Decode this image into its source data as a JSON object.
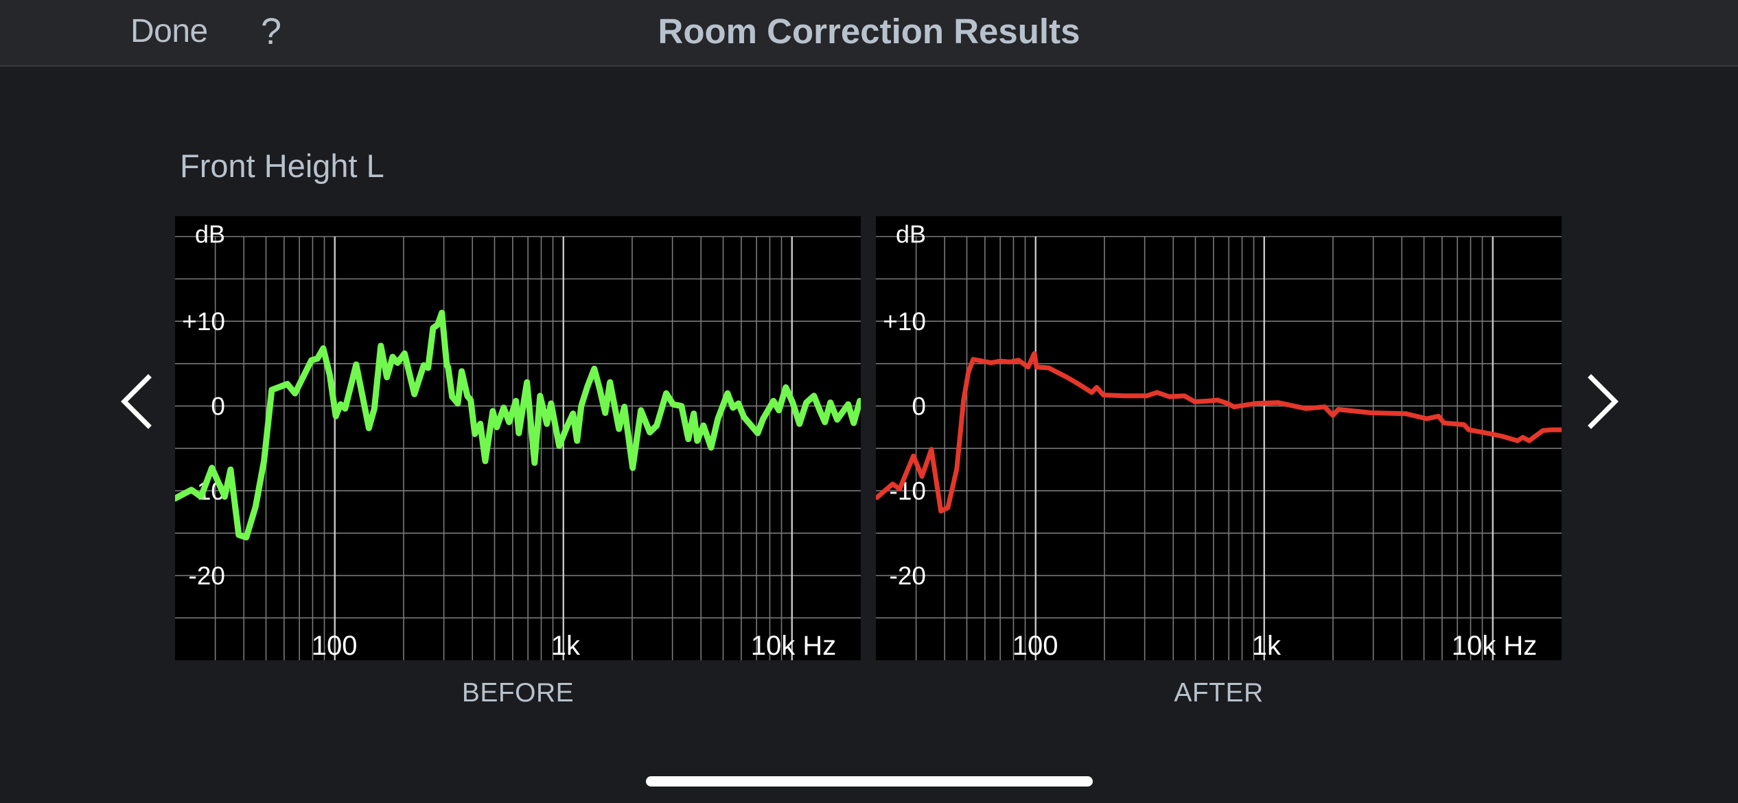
{
  "header": {
    "done_label": "Done",
    "help_label": "?",
    "title": "Room Correction Results"
  },
  "speaker": {
    "name": "Front Height L"
  },
  "navigation": {
    "prev_icon": "chevron-left-icon",
    "next_icon": "chevron-right-icon"
  },
  "colors": {
    "before_curve": "#72f74f",
    "after_curve": "#e5372a",
    "plot_background": "#000000",
    "grid_minor": "#7a7a7a",
    "grid_major": "#c8c8c8",
    "text": "#b8c2cc"
  },
  "chart_data": [
    {
      "type": "line",
      "title": "BEFORE",
      "xlabel": "Hz",
      "ylabel": "dB",
      "xscale": "log",
      "xlim": [
        20,
        20000
      ],
      "ylim": [
        -30,
        22.4
      ],
      "grid": true,
      "y_gridlines": [
        20,
        15,
        10,
        5,
        0,
        -5,
        -10,
        -15,
        -20,
        -25
      ],
      "x_gridlines": [
        30,
        40,
        50,
        60,
        70,
        80,
        90,
        100,
        200,
        300,
        400,
        500,
        600,
        700,
        800,
        900,
        1000,
        2000,
        3000,
        4000,
        5000,
        6000,
        7000,
        8000,
        9000,
        10000
      ],
      "x_major_gridlines": [
        100,
        1000,
        10000
      ],
      "y_tick_labels": [
        {
          "value": 10,
          "label": "+10"
        },
        {
          "value": 0,
          "label": "0"
        },
        {
          "value": -10,
          "label": "-10"
        },
        {
          "value": -20,
          "label": "-20"
        }
      ],
      "y_unit_label": "dB",
      "x_tick_labels": [
        {
          "value": 100,
          "label": "100"
        },
        {
          "value": 1000,
          "label": "1k"
        },
        {
          "value": 10000,
          "label": "10k Hz"
        }
      ],
      "series": [
        {
          "name": "Before",
          "color": "#72f74f",
          "points": [
            [
              20,
              -10.9
            ],
            [
              23.6,
              -9.9
            ],
            [
              26,
              -10.7
            ],
            [
              29,
              -7.3
            ],
            [
              33,
              -10.7
            ],
            [
              35,
              -7.5
            ],
            [
              38,
              -15.2
            ],
            [
              41,
              -15.5
            ],
            [
              45,
              -11.9
            ],
            [
              49,
              -6.5
            ],
            [
              53,
              1.9
            ],
            [
              62,
              2.6
            ],
            [
              67,
              1.5
            ],
            [
              79,
              5.4
            ],
            [
              84,
              5.6
            ],
            [
              89,
              6.8
            ],
            [
              95,
              3.7
            ],
            [
              101,
              -1.2
            ],
            [
              106,
              0.2
            ],
            [
              111,
              -0.3
            ],
            [
              124,
              4.9
            ],
            [
              141,
              -2.6
            ],
            [
              149,
              -0.3
            ],
            [
              159,
              7.1
            ],
            [
              169,
              3.4
            ],
            [
              179,
              5.8
            ],
            [
              188,
              5.1
            ],
            [
              202,
              6.2
            ],
            [
              223,
              1.4
            ],
            [
              245,
              4.8
            ],
            [
              256,
              4.5
            ],
            [
              269,
              9.2
            ],
            [
              282,
              9.6
            ],
            [
              294,
              11.0
            ],
            [
              309,
              4.8
            ],
            [
              313,
              4.6
            ],
            [
              326,
              1.1
            ],
            [
              345,
              0.3
            ],
            [
              359,
              4.1
            ],
            [
              380,
              1.2
            ],
            [
              393,
              0.7
            ],
            [
              410,
              -3.3
            ],
            [
              433,
              -2.1
            ],
            [
              455,
              -6.5
            ],
            [
              491,
              -0.6
            ],
            [
              511,
              -2.5
            ],
            [
              548,
              -0.2
            ],
            [
              579,
              -1.9
            ],
            [
              620,
              0.6
            ],
            [
              638,
              -3.2
            ],
            [
              693,
              2.8
            ],
            [
              748,
              -6.7
            ],
            [
              791,
              1.2
            ],
            [
              847,
              -2.1
            ],
            [
              883,
              0.3
            ],
            [
              959,
              -4.7
            ],
            [
              1042,
              -2.3
            ],
            [
              1102,
              -0.9
            ],
            [
              1148,
              -4.1
            ],
            [
              1197,
              0.0
            ],
            [
              1274,
              2.3
            ],
            [
              1365,
              4.4
            ],
            [
              1442,
              2.0
            ],
            [
              1524,
              -0.8
            ],
            [
              1600,
              2.8
            ],
            [
              1750,
              -2.7
            ],
            [
              1849,
              -0.1
            ],
            [
              2010,
              -7.3
            ],
            [
              2184,
              -0.5
            ],
            [
              2389,
              -3.1
            ],
            [
              2560,
              -2.3
            ],
            [
              2818,
              1.5
            ],
            [
              3020,
              0.2
            ],
            [
              3285,
              0.0
            ],
            [
              3521,
              -3.9
            ],
            [
              3720,
              -0.9
            ],
            [
              3853,
              -4.1
            ],
            [
              4100,
              -2.3
            ],
            [
              4426,
              -4.9
            ],
            [
              4742,
              -1.5
            ],
            [
              5224,
              1.5
            ],
            [
              5521,
              -0.2
            ],
            [
              5834,
              0.3
            ],
            [
              6166,
              -1.3
            ],
            [
              7079,
              -3.2
            ],
            [
              7482,
              -1.5
            ],
            [
              8299,
              0.6
            ],
            [
              8770,
              -0.5
            ],
            [
              9397,
              2.2
            ],
            [
              10069,
              0.4
            ],
            [
              10789,
              -2.1
            ],
            [
              11561,
              0.4
            ],
            [
              12477,
              1.2
            ],
            [
              13275,
              -0.6
            ],
            [
              13932,
              -1.9
            ],
            [
              14723,
              0.4
            ],
            [
              15776,
              -1.6
            ],
            [
              17620,
              0.2
            ],
            [
              18621,
              -2.0
            ],
            [
              19815,
              0.6
            ]
          ]
        }
      ]
    },
    {
      "type": "line",
      "title": "AFTER",
      "xlabel": "Hz",
      "ylabel": "dB",
      "xscale": "log",
      "xlim": [
        20,
        20000
      ],
      "ylim": [
        -30,
        22.4
      ],
      "grid": true,
      "y_gridlines": [
        20,
        15,
        10,
        5,
        0,
        -5,
        -10,
        -15,
        -20,
        -25
      ],
      "x_gridlines": [
        30,
        40,
        50,
        60,
        70,
        80,
        90,
        100,
        200,
        300,
        400,
        500,
        600,
        700,
        800,
        900,
        1000,
        2000,
        3000,
        4000,
        5000,
        6000,
        7000,
        8000,
        9000,
        10000
      ],
      "x_major_gridlines": [
        100,
        1000,
        10000
      ],
      "y_tick_labels": [
        {
          "value": 10,
          "label": "+10"
        },
        {
          "value": 0,
          "label": "0"
        },
        {
          "value": -10,
          "label": "-10"
        },
        {
          "value": -20,
          "label": "-20"
        }
      ],
      "y_unit_label": "dB",
      "x_tick_labels": [
        {
          "value": 100,
          "label": "100"
        },
        {
          "value": 1000,
          "label": "1k"
        },
        {
          "value": 10000,
          "label": "10k Hz"
        }
      ],
      "series": [
        {
          "name": "After",
          "color": "#e5372a",
          "points": [
            [
              20.2,
              -10.8
            ],
            [
              23.7,
              -9.2
            ],
            [
              25.4,
              -9.8
            ],
            [
              29.2,
              -5.9
            ],
            [
              31.8,
              -8.3
            ],
            [
              35,
              -5.1
            ],
            [
              38.5,
              -12.4
            ],
            [
              41.3,
              -12.0
            ],
            [
              45.2,
              -7.4
            ],
            [
              48.4,
              0.7
            ],
            [
              50.8,
              4.0
            ],
            [
              53.3,
              5.5
            ],
            [
              63.8,
              5.1
            ],
            [
              70.3,
              5.3
            ],
            [
              76.9,
              5.2
            ],
            [
              84.1,
              5.4
            ],
            [
              92.7,
              4.6
            ],
            [
              98.7,
              6.2
            ],
            [
              101,
              4.6
            ],
            [
              114,
              4.5
            ],
            [
              137,
              3.4
            ],
            [
              154,
              2.6
            ],
            [
              176,
              1.6
            ],
            [
              185,
              2.2
            ],
            [
              198,
              1.3
            ],
            [
              244,
              1.2
            ],
            [
              306,
              1.2
            ],
            [
              340,
              1.6
            ],
            [
              385,
              1.1
            ],
            [
              448,
              1.2
            ],
            [
              497,
              0.5
            ],
            [
              571,
              0.6
            ],
            [
              625,
              0.7
            ],
            [
              693,
              0.3
            ],
            [
              738,
              -0.1
            ],
            [
              914,
              0.3
            ],
            [
              1148,
              0.4
            ],
            [
              1525,
              -0.3
            ],
            [
              1837,
              -0.1
            ],
            [
              1996,
              -1.1
            ],
            [
              2110,
              -0.4
            ],
            [
              2939,
              -0.8
            ],
            [
              4155,
              -0.9
            ],
            [
              5150,
              -1.5
            ],
            [
              5794,
              -1.2
            ],
            [
              6120,
              -2.0
            ],
            [
              7484,
              -2.2
            ],
            [
              7855,
              -2.8
            ],
            [
              9865,
              -3.3
            ],
            [
              11093,
              -3.6
            ],
            [
              12823,
              -4.1
            ],
            [
              13552,
              -3.7
            ],
            [
              14424,
              -4.1
            ],
            [
              16561,
              -2.9
            ],
            [
              18113,
              -2.8
            ],
            [
              19963,
              -2.8
            ]
          ]
        }
      ]
    }
  ]
}
